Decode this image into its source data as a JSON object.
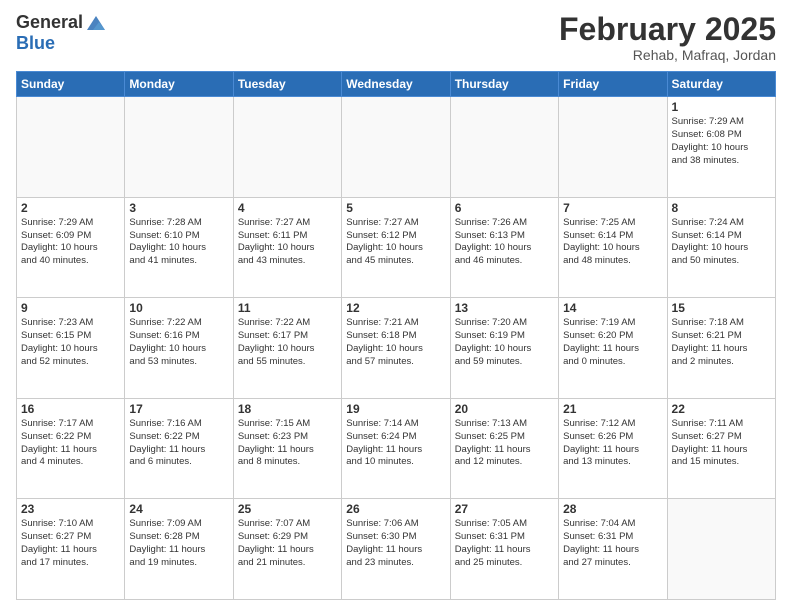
{
  "logo": {
    "general": "General",
    "blue": "Blue"
  },
  "title": "February 2025",
  "location": "Rehab, Mafraq, Jordan",
  "days_of_week": [
    "Sunday",
    "Monday",
    "Tuesday",
    "Wednesday",
    "Thursday",
    "Friday",
    "Saturday"
  ],
  "weeks": [
    [
      {
        "day": "",
        "info": ""
      },
      {
        "day": "",
        "info": ""
      },
      {
        "day": "",
        "info": ""
      },
      {
        "day": "",
        "info": ""
      },
      {
        "day": "",
        "info": ""
      },
      {
        "day": "",
        "info": ""
      },
      {
        "day": "1",
        "info": "Sunrise: 7:29 AM\nSunset: 6:08 PM\nDaylight: 10 hours\nand 38 minutes."
      }
    ],
    [
      {
        "day": "2",
        "info": "Sunrise: 7:29 AM\nSunset: 6:09 PM\nDaylight: 10 hours\nand 40 minutes."
      },
      {
        "day": "3",
        "info": "Sunrise: 7:28 AM\nSunset: 6:10 PM\nDaylight: 10 hours\nand 41 minutes."
      },
      {
        "day": "4",
        "info": "Sunrise: 7:27 AM\nSunset: 6:11 PM\nDaylight: 10 hours\nand 43 minutes."
      },
      {
        "day": "5",
        "info": "Sunrise: 7:27 AM\nSunset: 6:12 PM\nDaylight: 10 hours\nand 45 minutes."
      },
      {
        "day": "6",
        "info": "Sunrise: 7:26 AM\nSunset: 6:13 PM\nDaylight: 10 hours\nand 46 minutes."
      },
      {
        "day": "7",
        "info": "Sunrise: 7:25 AM\nSunset: 6:14 PM\nDaylight: 10 hours\nand 48 minutes."
      },
      {
        "day": "8",
        "info": "Sunrise: 7:24 AM\nSunset: 6:14 PM\nDaylight: 10 hours\nand 50 minutes."
      }
    ],
    [
      {
        "day": "9",
        "info": "Sunrise: 7:23 AM\nSunset: 6:15 PM\nDaylight: 10 hours\nand 52 minutes."
      },
      {
        "day": "10",
        "info": "Sunrise: 7:22 AM\nSunset: 6:16 PM\nDaylight: 10 hours\nand 53 minutes."
      },
      {
        "day": "11",
        "info": "Sunrise: 7:22 AM\nSunset: 6:17 PM\nDaylight: 10 hours\nand 55 minutes."
      },
      {
        "day": "12",
        "info": "Sunrise: 7:21 AM\nSunset: 6:18 PM\nDaylight: 10 hours\nand 57 minutes."
      },
      {
        "day": "13",
        "info": "Sunrise: 7:20 AM\nSunset: 6:19 PM\nDaylight: 10 hours\nand 59 minutes."
      },
      {
        "day": "14",
        "info": "Sunrise: 7:19 AM\nSunset: 6:20 PM\nDaylight: 11 hours\nand 0 minutes."
      },
      {
        "day": "15",
        "info": "Sunrise: 7:18 AM\nSunset: 6:21 PM\nDaylight: 11 hours\nand 2 minutes."
      }
    ],
    [
      {
        "day": "16",
        "info": "Sunrise: 7:17 AM\nSunset: 6:22 PM\nDaylight: 11 hours\nand 4 minutes."
      },
      {
        "day": "17",
        "info": "Sunrise: 7:16 AM\nSunset: 6:22 PM\nDaylight: 11 hours\nand 6 minutes."
      },
      {
        "day": "18",
        "info": "Sunrise: 7:15 AM\nSunset: 6:23 PM\nDaylight: 11 hours\nand 8 minutes."
      },
      {
        "day": "19",
        "info": "Sunrise: 7:14 AM\nSunset: 6:24 PM\nDaylight: 11 hours\nand 10 minutes."
      },
      {
        "day": "20",
        "info": "Sunrise: 7:13 AM\nSunset: 6:25 PM\nDaylight: 11 hours\nand 12 minutes."
      },
      {
        "day": "21",
        "info": "Sunrise: 7:12 AM\nSunset: 6:26 PM\nDaylight: 11 hours\nand 13 minutes."
      },
      {
        "day": "22",
        "info": "Sunrise: 7:11 AM\nSunset: 6:27 PM\nDaylight: 11 hours\nand 15 minutes."
      }
    ],
    [
      {
        "day": "23",
        "info": "Sunrise: 7:10 AM\nSunset: 6:27 PM\nDaylight: 11 hours\nand 17 minutes."
      },
      {
        "day": "24",
        "info": "Sunrise: 7:09 AM\nSunset: 6:28 PM\nDaylight: 11 hours\nand 19 minutes."
      },
      {
        "day": "25",
        "info": "Sunrise: 7:07 AM\nSunset: 6:29 PM\nDaylight: 11 hours\nand 21 minutes."
      },
      {
        "day": "26",
        "info": "Sunrise: 7:06 AM\nSunset: 6:30 PM\nDaylight: 11 hours\nand 23 minutes."
      },
      {
        "day": "27",
        "info": "Sunrise: 7:05 AM\nSunset: 6:31 PM\nDaylight: 11 hours\nand 25 minutes."
      },
      {
        "day": "28",
        "info": "Sunrise: 7:04 AM\nSunset: 6:31 PM\nDaylight: 11 hours\nand 27 minutes."
      },
      {
        "day": "",
        "info": ""
      }
    ]
  ]
}
